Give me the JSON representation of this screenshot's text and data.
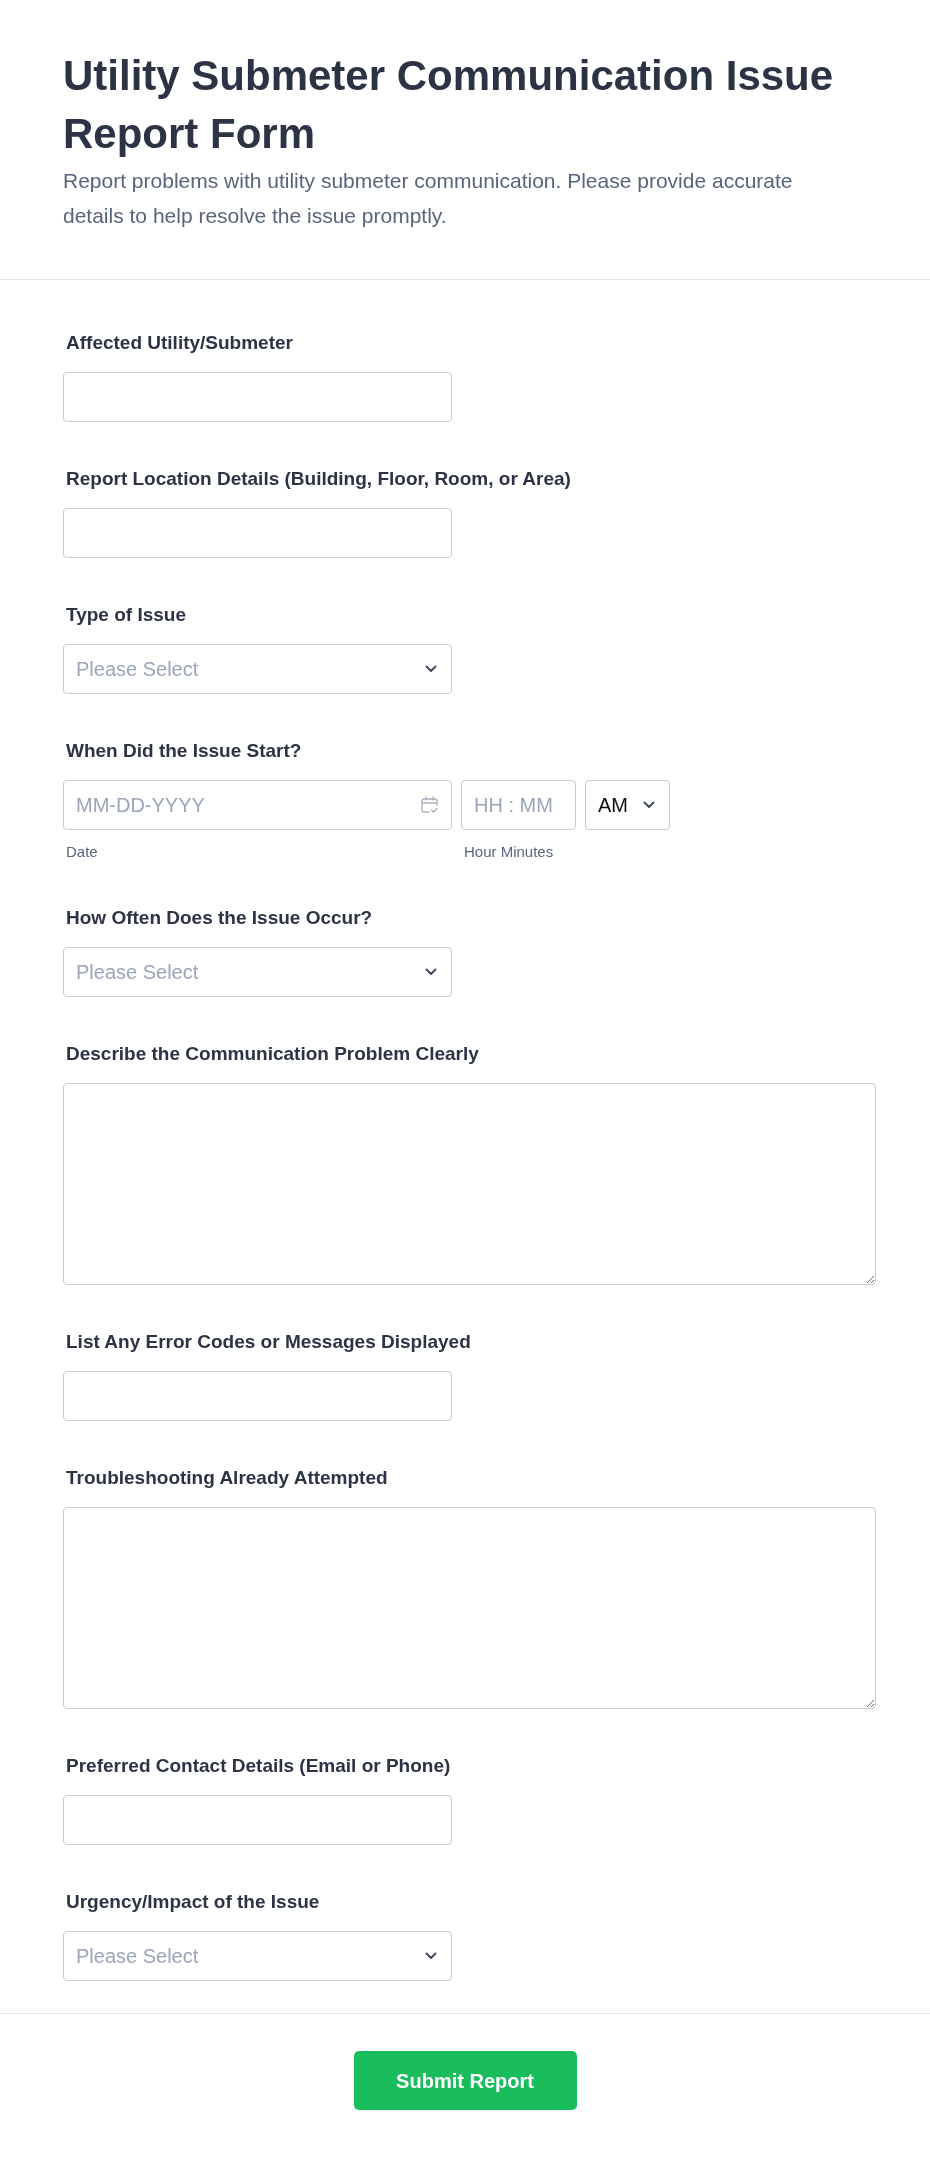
{
  "header": {
    "title": "Utility Submeter Communication Issue Report Form",
    "description": "Report problems with utility submeter communication. Please provide accurate details to help resolve the issue promptly."
  },
  "fields": [
    {
      "kind": "text",
      "label": "Affected Utility/Submeter"
    },
    {
      "kind": "text",
      "label": "Report Location Details (Building, Floor, Room, or Area)"
    },
    {
      "kind": "select",
      "label": "Type of Issue",
      "placeholder": "Please Select"
    },
    {
      "kind": "datetime",
      "label": "When Did the Issue Start?",
      "date": {
        "placeholder": "MM-DD-YYYY",
        "sublabel": "Date"
      },
      "time": {
        "placeholder": "HH : MM",
        "sublabel": "Hour Minutes"
      },
      "period": {
        "value": "AM"
      }
    },
    {
      "kind": "select",
      "label": "How Often Does the Issue Occur?",
      "placeholder": "Please Select"
    },
    {
      "kind": "textarea",
      "label": "Describe the Communication Problem Clearly"
    },
    {
      "kind": "text",
      "label": "List Any Error Codes or Messages Displayed"
    },
    {
      "kind": "textarea",
      "label": "Troubleshooting Already Attempted"
    },
    {
      "kind": "text",
      "label": "Preferred Contact Details (Email or Phone)"
    },
    {
      "kind": "select",
      "label": "Urgency/Impact of the Issue",
      "placeholder": "Please Select"
    }
  ],
  "submit": {
    "label": "Submit Report"
  }
}
